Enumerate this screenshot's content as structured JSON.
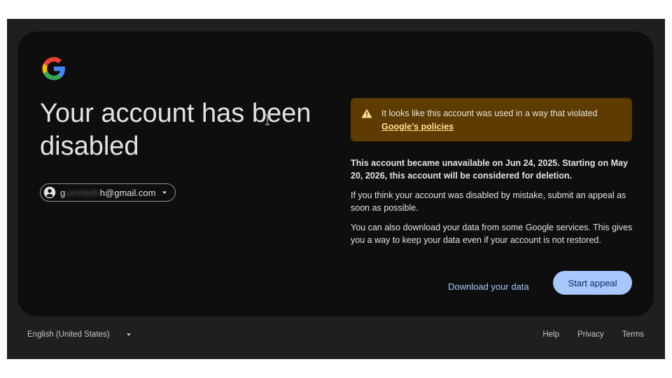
{
  "page": {
    "title_line1": "Your account has been",
    "title_line2": "disabled"
  },
  "account": {
    "email_first": "g",
    "email_hidden": "uesfaith",
    "email_rest": "h@gmail.com"
  },
  "alert": {
    "text": "It looks like this account was used in a way that violated",
    "link_text": "Google’s policies"
  },
  "body": {
    "p1": "This account became unavailable on Jun 24, 2025. Starting on May 20, 2026, this account will be considered for deletion.",
    "p2": "If you think your account was disabled by mistake, submit an appeal as soon as possible.",
    "p3": "You can also download your data from some Google services. This gives you a way to keep your data even if your account is not restored."
  },
  "actions": {
    "download_label": "Download your data",
    "appeal_label": "Start appeal"
  },
  "footer": {
    "language": "English (United States)",
    "links": [
      "Help",
      "Privacy",
      "Terms"
    ]
  },
  "icons": {
    "logo": "google-g-logo",
    "avatar": "account-circle-icon",
    "warning": "warning-triangle-icon",
    "caret": "caret-down-icon",
    "cursor": "text-cursor-icon"
  },
  "colors": {
    "background": "#1f1f1f",
    "card": "#0e0e0e",
    "alert_bg": "#5e3b00",
    "alert_link": "#fde293",
    "accent": "#a8c7fa"
  }
}
